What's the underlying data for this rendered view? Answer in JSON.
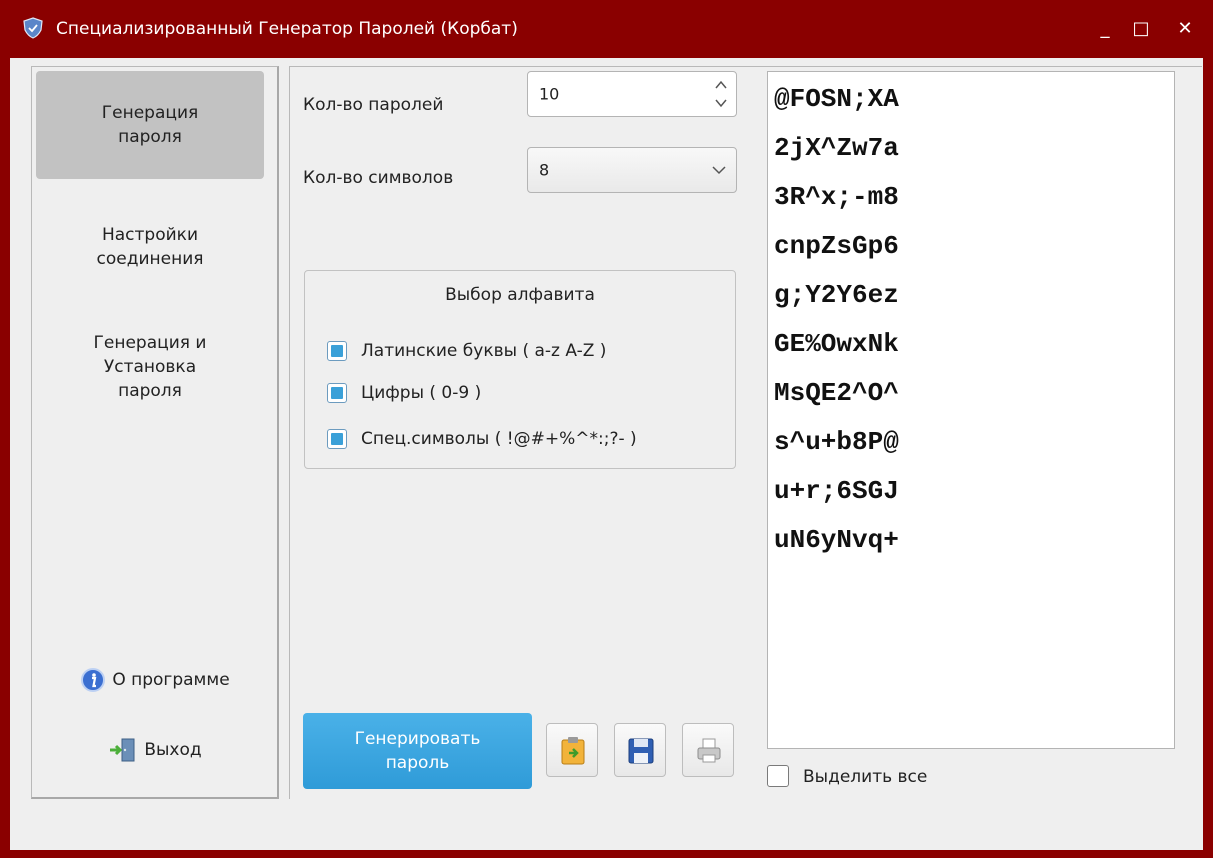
{
  "window": {
    "title": "Специализированный Генератор Паролей (Корбат)",
    "minimize": "_",
    "maximize": "□",
    "close": "✕"
  },
  "sidebar": {
    "items": [
      {
        "label": "Генерация\nпароля",
        "active": true
      },
      {
        "label": "Настройки\nсоединения",
        "active": false
      },
      {
        "label": "Генерация и\nУстановка\nпароля",
        "active": false
      }
    ],
    "about_label": "О программе",
    "exit_label": "Выход"
  },
  "form": {
    "count_label": "Кол-во паролей",
    "count_value": "10",
    "length_label": "Кол-во символов",
    "length_value": "8"
  },
  "alphabet": {
    "title": "Выбор алфавита",
    "options": [
      {
        "label": "Латинские буквы ( a-z A-Z )",
        "checked": true
      },
      {
        "label": "Цифры ( 0-9 )",
        "checked": true
      },
      {
        "label": "Спец.символы ( !@#+%^*:;?- )",
        "checked": true
      }
    ]
  },
  "actions": {
    "generate_label": "Генерировать\nпароль",
    "copy_icon": "clipboard-icon",
    "save_icon": "floppy-icon",
    "print_icon": "printer-icon"
  },
  "output": {
    "passwords": [
      "@FOSN;XA",
      "2jX^Zw7a",
      "3R^x;-m8",
      "cnpZsGp6",
      "g;Y2Y6ez",
      "GE%OwxNk",
      "MsQE2^O^",
      "s^u+b8P@",
      "u+r;6SGJ",
      "uN6yNvq+"
    ],
    "select_all_label": "Выделить все",
    "select_all_checked": false
  },
  "colors": {
    "titlebar": "#8a0000",
    "accent": "#3aa0d8",
    "button": "#3aa4de"
  }
}
